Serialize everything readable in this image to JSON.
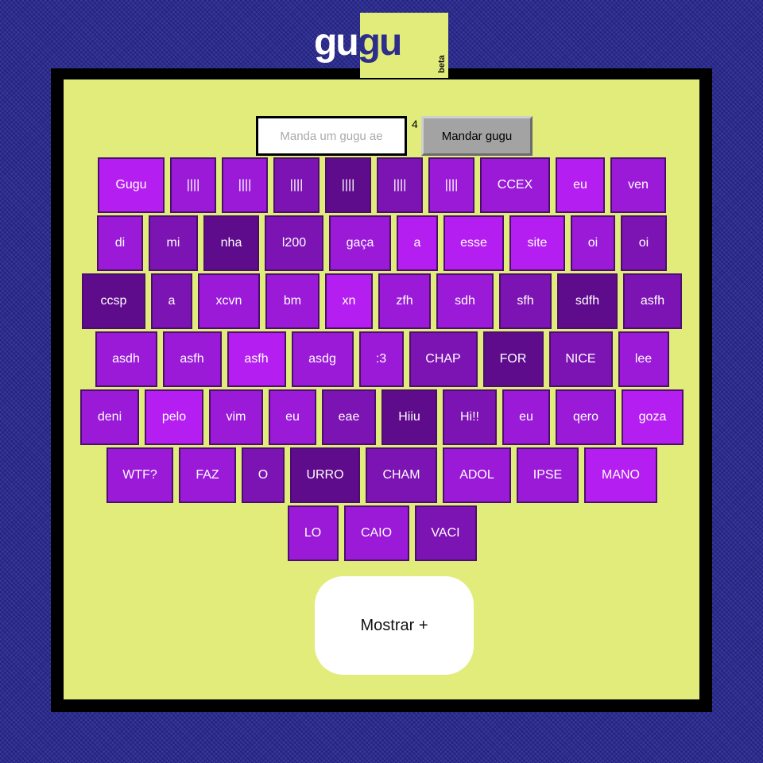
{
  "logo": {
    "part1": "gu",
    "part2": "gu",
    "badge": "beta"
  },
  "composer": {
    "input_value": "",
    "input_placeholder": "Manda um gugu ae",
    "counter": "4",
    "send_label": "Mandar gugu"
  },
  "colors": {
    "background": "#2d2d8c",
    "panel": "#e1ec7a",
    "frame": "#000000",
    "key_border": "#4a0e6e",
    "key_shades": [
      "#b51ef0",
      "#9a1ad8",
      "#7c13b3",
      "#5e0b8c"
    ]
  },
  "keys": {
    "rows": [
      [
        {
          "label": "Gugu",
          "shade": 0
        },
        {
          "label": "||||",
          "shade": 1
        },
        {
          "label": "||||",
          "shade": 1
        },
        {
          "label": "||||",
          "shade": 2
        },
        {
          "label": "||||",
          "shade": 3
        },
        {
          "label": "||||",
          "shade": 2
        },
        {
          "label": "||||",
          "shade": 1
        },
        {
          "label": "CCEX",
          "shade": 1
        },
        {
          "label": "eu",
          "shade": 0
        },
        {
          "label": "ven",
          "shade": 1
        }
      ],
      [
        {
          "label": "di",
          "shade": 1
        },
        {
          "label": "mi",
          "shade": 2
        },
        {
          "label": "nha",
          "shade": 3
        },
        {
          "label": "l200",
          "shade": 2
        },
        {
          "label": "gaça",
          "shade": 1
        },
        {
          "label": "a",
          "shade": 0
        },
        {
          "label": "esse",
          "shade": 0
        },
        {
          "label": "site",
          "shade": 0
        },
        {
          "label": "oi",
          "shade": 1
        },
        {
          "label": "oi",
          "shade": 2
        }
      ],
      [
        {
          "label": "ccsp",
          "shade": 3
        },
        {
          "label": "a",
          "shade": 2
        },
        {
          "label": "xcvn",
          "shade": 1
        },
        {
          "label": "bm",
          "shade": 1
        },
        {
          "label": "xn",
          "shade": 0
        },
        {
          "label": "zfh",
          "shade": 1
        },
        {
          "label": "sdh",
          "shade": 1
        },
        {
          "label": "sfh",
          "shade": 2
        },
        {
          "label": "sdfh",
          "shade": 3
        },
        {
          "label": "asfh",
          "shade": 2
        }
      ],
      [
        {
          "label": "asdh",
          "shade": 1
        },
        {
          "label": "asfh",
          "shade": 1
        },
        {
          "label": "asfh",
          "shade": 0
        },
        {
          "label": "asdg",
          "shade": 1
        },
        {
          "label": ":3",
          "shade": 1
        },
        {
          "label": "CHAP",
          "shade": 2
        },
        {
          "label": "FOR",
          "shade": 3
        },
        {
          "label": "NICE",
          "shade": 2
        },
        {
          "label": "lee",
          "shade": 1
        }
      ],
      [
        {
          "label": "deni",
          "shade": 1
        },
        {
          "label": "pelo",
          "shade": 0
        },
        {
          "label": "vim",
          "shade": 1
        },
        {
          "label": "eu",
          "shade": 1
        },
        {
          "label": "eae",
          "shade": 2
        },
        {
          "label": "Hiiu",
          "shade": 3
        },
        {
          "label": "Hi!!",
          "shade": 2
        },
        {
          "label": "eu",
          "shade": 1
        },
        {
          "label": "qero",
          "shade": 1
        },
        {
          "label": "goza",
          "shade": 0
        }
      ],
      [
        {
          "label": "WTF?",
          "shade": 1
        },
        {
          "label": "FAZ",
          "shade": 1
        },
        {
          "label": "O",
          "shade": 2
        },
        {
          "label": "URRO",
          "shade": 3
        },
        {
          "label": "CHAM",
          "shade": 2
        },
        {
          "label": "ADOL",
          "shade": 1
        },
        {
          "label": "IPSE",
          "shade": 1
        },
        {
          "label": "MANO",
          "shade": 0
        }
      ],
      [
        {
          "label": "LO",
          "shade": 1
        },
        {
          "label": "CAIO",
          "shade": 1
        },
        {
          "label": "VACI",
          "shade": 2
        }
      ]
    ]
  },
  "more": {
    "label": "Mostrar +"
  }
}
